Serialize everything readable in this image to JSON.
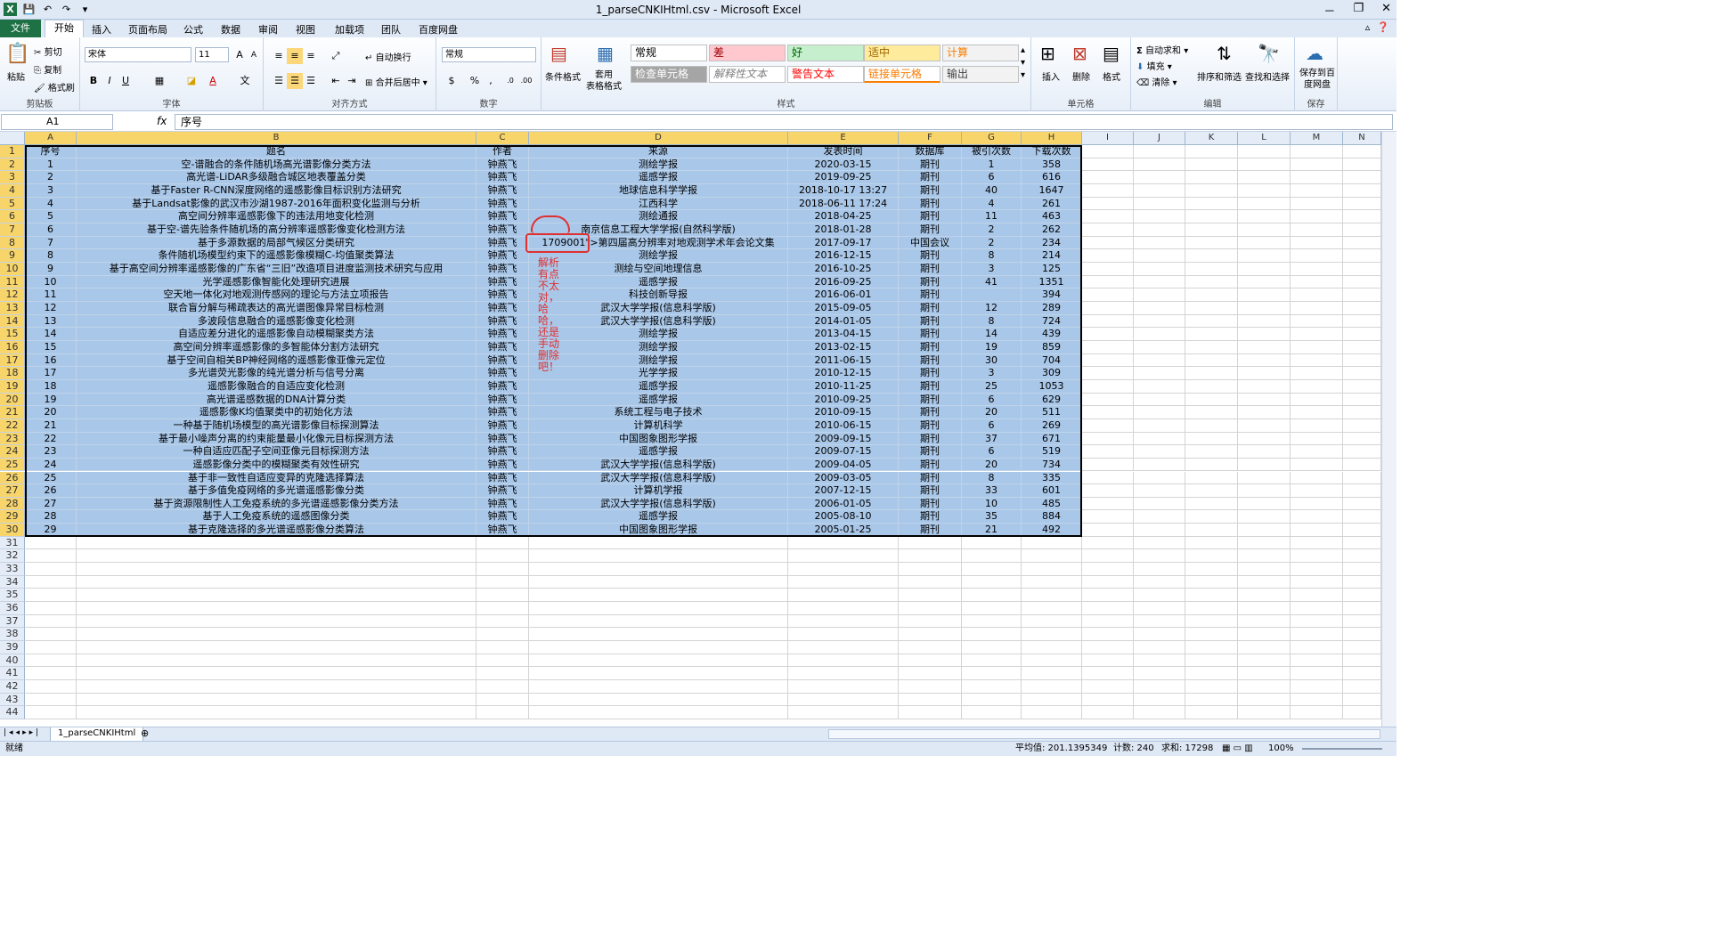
{
  "window": {
    "title": "1_parseCNKIHtml.csv - Microsoft Excel",
    "min": "－",
    "restore": "❐",
    "close": "✕"
  },
  "ribbon_tabs": [
    "文件",
    "开始",
    "插入",
    "页面布局",
    "公式",
    "数据",
    "审阅",
    "视图",
    "加载项",
    "团队",
    "百度网盘"
  ],
  "ribbon": {
    "clipboard": {
      "paste": "粘贴",
      "cut": "剪切",
      "copy": "复制",
      "format_painter": "格式刷",
      "label": "剪贴板"
    },
    "font": {
      "name": "宋体",
      "size": "11",
      "label": "字体"
    },
    "alignment": {
      "wrap": "自动换行",
      "merge": "合并后居中",
      "label": "对齐方式"
    },
    "number": {
      "format": "常规",
      "label": "数字"
    },
    "styles": {
      "cond_format": "条件格式",
      "table_format": "套用\n表格格式",
      "items": [
        {
          "text": "常规",
          "bg": "#ffffff",
          "fg": "#000000"
        },
        {
          "text": "差",
          "bg": "#ffc7ce",
          "fg": "#9c0006"
        },
        {
          "text": "好",
          "bg": "#c6efce",
          "fg": "#006100"
        },
        {
          "text": "适中",
          "bg": "#ffeb9c",
          "fg": "#9c6500"
        },
        {
          "text": "计算",
          "bg": "#f2f2f2",
          "fg": "#fa7d00"
        },
        {
          "text": "检查单元格",
          "bg": "#a5a5a5",
          "fg": "#ffffff"
        },
        {
          "text": "解释性文本",
          "bg": "#ffffff",
          "fg": "#7f7f7f"
        },
        {
          "text": "警告文本",
          "bg": "#ffffff",
          "fg": "#ff0000"
        },
        {
          "text": "链接单元格",
          "bg": "#ffffff",
          "fg": "#fa7d00"
        },
        {
          "text": "输出",
          "bg": "#f2f2f2",
          "fg": "#3f3f3f"
        }
      ],
      "label": "样式"
    },
    "cells": {
      "insert": "插入",
      "delete": "删除",
      "format": "格式",
      "label": "单元格"
    },
    "editing": {
      "autosum": "自动求和",
      "fill": "填充",
      "clear": "清除",
      "sort": "排序和筛选",
      "find": "查找和选择",
      "label": "编辑"
    },
    "save": {
      "save_baidu": "保存到百度网盘",
      "label": "保存"
    }
  },
  "formula_bar": {
    "name_box": "A1",
    "fx": "fx",
    "content": "序号"
  },
  "columns": [
    "A",
    "B",
    "C",
    "D",
    "E",
    "F",
    "G",
    "H",
    "I",
    "J",
    "K",
    "L",
    "M",
    "N"
  ],
  "headers": [
    "序号",
    "题名",
    "作者",
    "来源",
    "发表时间",
    "数据库",
    "被引次数",
    "下载次数"
  ],
  "rows": [
    [
      "1",
      "空-谱融合的条件随机场高光谱影像分类方法",
      "钟燕飞",
      "测绘学报",
      "2020-03-15",
      "期刊",
      "1",
      "358"
    ],
    [
      "2",
      "高光谱-LiDAR多级融合城区地表覆盖分类",
      "钟燕飞",
      "遥感学报",
      "2019-09-25",
      "期刊",
      "6",
      "616"
    ],
    [
      "3",
      "基于Faster R-CNN深度网络的遥感影像目标识别方法研究",
      "钟燕飞",
      "地球信息科学学报",
      "2018-10-17 13:27",
      "期刊",
      "40",
      "1647"
    ],
    [
      "4",
      "基于Landsat影像的武汉市沙湖1987-2016年面积变化监测与分析",
      "钟燕飞",
      "江西科学",
      "2018-06-11 17:24",
      "期刊",
      "4",
      "261"
    ],
    [
      "5",
      "高空间分辨率遥感影像下的违法用地变化检测",
      "钟燕飞",
      "测绘通报",
      "2018-04-25",
      "期刊",
      "11",
      "463"
    ],
    [
      "6",
      "基于空-谱先验条件随机场的高分辨率遥感影像变化检测方法",
      "钟燕飞",
      "南京信息工程大学学报(自然科学版)",
      "2018-01-28",
      "期刊",
      "2",
      "262"
    ],
    [
      "7",
      "基于多源数据的局部气候区分类研究",
      "钟燕飞",
      "1709001\">第四届高分辨率对地观测学术年会论文集",
      "2017-09-17",
      "中国会议",
      "2",
      "234"
    ],
    [
      "8",
      "条件随机场模型约束下的遥感影像模糊C-均值聚类算法",
      "钟燕飞",
      "测绘学报",
      "2016-12-15",
      "期刊",
      "8",
      "214"
    ],
    [
      "9",
      "基于高空间分辨率遥感影像的广东省“三旧”改造项目进度监测技术研究与应用",
      "钟燕飞",
      "测绘与空间地理信息",
      "2016-10-25",
      "期刊",
      "3",
      "125"
    ],
    [
      "10",
      "光学遥感影像智能化处理研究进展",
      "钟燕飞",
      "遥感学报",
      "2016-09-25",
      "期刊",
      "41",
      "1351"
    ],
    [
      "11",
      "空天地一体化对地观测传感网的理论与方法立项报告",
      "钟燕飞",
      "科技创新导报",
      "2016-06-01",
      "期刊",
      "",
      "394"
    ],
    [
      "12",
      "联合盲分解与稀疏表达的高光谱图像异常目标检测",
      "钟燕飞",
      "武汉大学学报(信息科学版)",
      "2015-09-05",
      "期刊",
      "12",
      "289"
    ],
    [
      "13",
      "多波段信息融合的遥感影像变化检测",
      "钟燕飞",
      "武汉大学学报(信息科学版)",
      "2014-01-05",
      "期刊",
      "8",
      "724"
    ],
    [
      "14",
      "自适应差分进化的遥感影像自动模糊聚类方法",
      "钟燕飞",
      "测绘学报",
      "2013-04-15",
      "期刊",
      "14",
      "439"
    ],
    [
      "15",
      "高空间分辨率遥感影像的多智能体分割方法研究",
      "钟燕飞",
      "测绘学报",
      "2013-02-15",
      "期刊",
      "19",
      "859"
    ],
    [
      "16",
      "基于空间自相关BP神经网络的遥感影像亚像元定位",
      "钟燕飞",
      "测绘学报",
      "2011-06-15",
      "期刊",
      "30",
      "704"
    ],
    [
      "17",
      "多光谱荧光影像的纯光谱分析与信号分离",
      "钟燕飞",
      "光学学报",
      "2010-12-15",
      "期刊",
      "3",
      "309"
    ],
    [
      "18",
      "遥感影像融合的自适应变化检测",
      "钟燕飞",
      "遥感学报",
      "2010-11-25",
      "期刊",
      "25",
      "1053"
    ],
    [
      "19",
      "高光谱遥感数据的DNA计算分类",
      "钟燕飞",
      "遥感学报",
      "2010-09-25",
      "期刊",
      "6",
      "629"
    ],
    [
      "20",
      "遥感影像K均值聚类中的初始化方法",
      "钟燕飞",
      "系统工程与电子技术",
      "2010-09-15",
      "期刊",
      "20",
      "511"
    ],
    [
      "21",
      "一种基于随机场模型的高光谱影像目标探测算法",
      "钟燕飞",
      "计算机科学",
      "2010-06-15",
      "期刊",
      "6",
      "269"
    ],
    [
      "22",
      "基于最小噪声分离的约束能量最小化像元目标探测方法",
      "钟燕飞",
      "中国图象图形学报",
      "2009-09-15",
      "期刊",
      "37",
      "671"
    ],
    [
      "23",
      "一种自适应匹配子空间亚像元目标探测方法",
      "钟燕飞",
      "遥感学报",
      "2009-07-15",
      "期刊",
      "6",
      "519"
    ],
    [
      "24",
      "遥感影像分类中的模糊聚类有效性研究",
      "钟燕飞",
      "武汉大学学报(信息科学版)",
      "2009-04-05",
      "期刊",
      "20",
      "734"
    ],
    [
      "25",
      "基于非一致性自适应变异的克隆选择算法",
      "钟燕飞",
      "武汉大学学报(信息科学版)",
      "2009-03-05",
      "期刊",
      "8",
      "335"
    ],
    [
      "26",
      "基于多值免疫网络的多光谱遥感影像分类",
      "钟燕飞",
      "计算机学报",
      "2007-12-15",
      "期刊",
      "33",
      "601"
    ],
    [
      "27",
      "基于资源限制性人工免疫系统的多光谱遥感影像分类方法",
      "钟燕飞",
      "武汉大学学报(信息科学版)",
      "2006-01-05",
      "期刊",
      "10",
      "485"
    ],
    [
      "28",
      "基于人工免疫系统的遥感图像分类",
      "钟燕飞",
      "遥感学报",
      "2005-08-10",
      "期刊",
      "35",
      "884"
    ],
    [
      "29",
      "基于克隆选择的多光谱遥感影像分类算法",
      "钟燕飞",
      "中国图象图形学报",
      "2005-01-25",
      "期刊",
      "21",
      "492"
    ]
  ],
  "empty_rows": [
    "31",
    "32",
    "33",
    "34",
    "35",
    "36",
    "37",
    "38",
    "39",
    "40",
    "41",
    "42",
    "43",
    "44"
  ],
  "annotation": "解析有点不太对，哈哈，还是手动删除吧！",
  "sheet_tab": "1_parseCNKIHtml",
  "status": {
    "ready": "就绪",
    "average": "平均值: 201.1395349",
    "count": "计数: 240",
    "sum": "求和: 17298",
    "zoom": "100%"
  }
}
